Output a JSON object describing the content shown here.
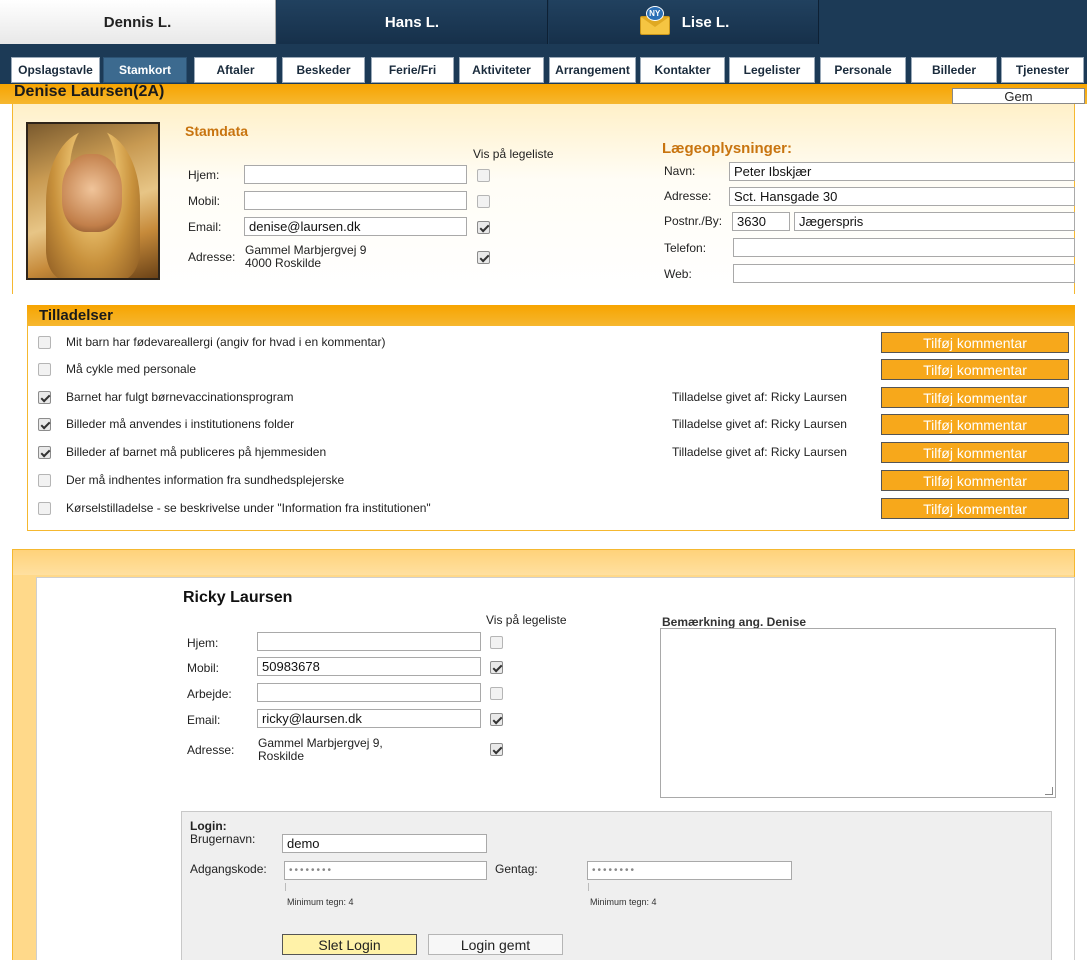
{
  "child_tabs": [
    {
      "label": "Dennis L.",
      "active": true
    },
    {
      "label": "Hans L.",
      "active": false
    },
    {
      "label": "Lise L.",
      "active": false,
      "badge": "NY"
    }
  ],
  "nav_tabs": [
    "Opslagstavle",
    "Stamkort",
    "Aftaler",
    "Beskeder",
    "Ferie/Fri",
    "Aktiviteter",
    "Arrangement",
    "Kontakter",
    "Legelister",
    "Personale",
    "Billeder",
    "Tjenester"
  ],
  "nav_active": "Stamkort",
  "title": "Denise Laursen(2A)",
  "save_label": "Gem",
  "stamdata": {
    "heading": "Stamdata",
    "vis_label": "Vis på legeliste",
    "hjem_label": "Hjem:",
    "hjem_value": "",
    "mobil_label": "Mobil:",
    "mobil_value": "",
    "email_label": "Email:",
    "email_value": "denise@laursen.dk",
    "adresse_label": "Adresse:",
    "adresse_line1": "Gammel Marbjergvej 9",
    "adresse_line2": "4000 Roskilde"
  },
  "doctor": {
    "heading": "Lægeoplysninger:",
    "navn_label": "Navn:",
    "navn_value": "Peter Ibskjær",
    "adresse_label": "Adresse:",
    "adresse_value": "Sct. Hansgade 30",
    "postnr_label": "Postnr./By:",
    "postnr_value": "3630",
    "by_value": "Jægerspris",
    "telefon_label": "Telefon:",
    "telefon_value": "",
    "web_label": "Web:",
    "web_value": ""
  },
  "permissions": {
    "heading": "Tilladelser",
    "button_label": "Tilføj kommentar",
    "items": [
      {
        "text": "Mit barn har fødevareallergi (angiv for hvad i en kommentar)",
        "checked": false,
        "given_by": ""
      },
      {
        "text": "Må cykle med personale",
        "checked": false,
        "given_by": ""
      },
      {
        "text": "Barnet har fulgt børnevaccinationsprogram",
        "checked": true,
        "given_by": "Tilladelse givet af: Ricky Laursen"
      },
      {
        "text": "Billeder må anvendes i institutionens folder",
        "checked": true,
        "given_by": "Tilladelse givet af: Ricky Laursen"
      },
      {
        "text": "Billeder af barnet må publiceres på hjemmesiden",
        "checked": true,
        "given_by": "Tilladelse givet af: Ricky Laursen"
      },
      {
        "text": "Der må indhentes information fra sundhedsplejerske",
        "checked": false,
        "given_by": ""
      },
      {
        "text": "Kørselstilladelse - se beskrivelse under \"Information fra institutionen\"",
        "checked": false,
        "given_by": ""
      }
    ]
  },
  "parent": {
    "name": "Ricky Laursen",
    "vis_label": "Vis på legeliste",
    "hjem_label": "Hjem:",
    "hjem_value": "",
    "mobil_label": "Mobil:",
    "mobil_value": "50983678",
    "arbejde_label": "Arbejde:",
    "arbejde_value": "",
    "email_label": "Email:",
    "email_value": "ricky@laursen.dk",
    "adresse_label": "Adresse:",
    "adresse_line1": "Gammel Marbjergvej 9,",
    "adresse_line2": "Roskilde",
    "remark_label": "Bemærkning ang. Denise",
    "remark_value": ""
  },
  "login": {
    "heading": "Login:",
    "username_label": "Brugernavn:",
    "username_value": "demo",
    "password_label": "Adgangskode:",
    "password_value": "••••••••",
    "repeat_label": "Gentag:",
    "repeat_value": "••••••••",
    "min_hint": "Minimum tegn: 4",
    "delete_label": "Slet Login",
    "saved_label": "Login gemt"
  }
}
